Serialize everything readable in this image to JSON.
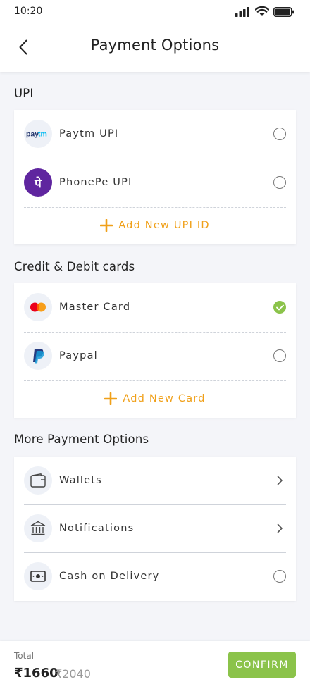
{
  "status": {
    "time": "10:20",
    "icons": [
      "signal-icon",
      "wifi-icon",
      "battery-icon"
    ]
  },
  "header": {
    "back_icon": "chevron-left-icon",
    "title": "Payment Options"
  },
  "upi": {
    "section_title": "UPI",
    "items": [
      {
        "label": "Paytm UPI",
        "logo": "Paytm",
        "state": "unselected"
      },
      {
        "label": "PhonePe UPI",
        "logo": "पे",
        "state": "unselected"
      }
    ],
    "add_label": "Add New UPI ID"
  },
  "cards": {
    "section_title": "Credit & Debit cards",
    "items": [
      {
        "label": "Master Card",
        "state": "selected"
      },
      {
        "label": "Paypal",
        "state": "unselected"
      }
    ],
    "add_label": "Add New Card"
  },
  "more": {
    "section_title": "More Payment Options",
    "items": [
      {
        "label": "Wallets",
        "icon": "wallet-icon",
        "action": "chevron"
      },
      {
        "label": "Notifications",
        "icon": "bank-icon",
        "action": "chevron"
      },
      {
        "label": "Cash on Delivery",
        "icon": "cash-icon",
        "action": "radio"
      }
    ]
  },
  "footer": {
    "total_label": "Total",
    "price": "₹1660",
    "original_price": "₹2040",
    "confirm_label": "CONFIRM"
  },
  "colors": {
    "accent_orange": "#f0a019",
    "confirm_green": "#8bc34a",
    "phonepe_purple": "#5f259f",
    "paytm_blue": "#00baf2",
    "paytm_navy": "#20336b",
    "paypal_blue": "#253b80",
    "paypal_light": "#179bd7",
    "mastercard_red": "#eb001b",
    "mastercard_yellow": "#f79e1b"
  }
}
